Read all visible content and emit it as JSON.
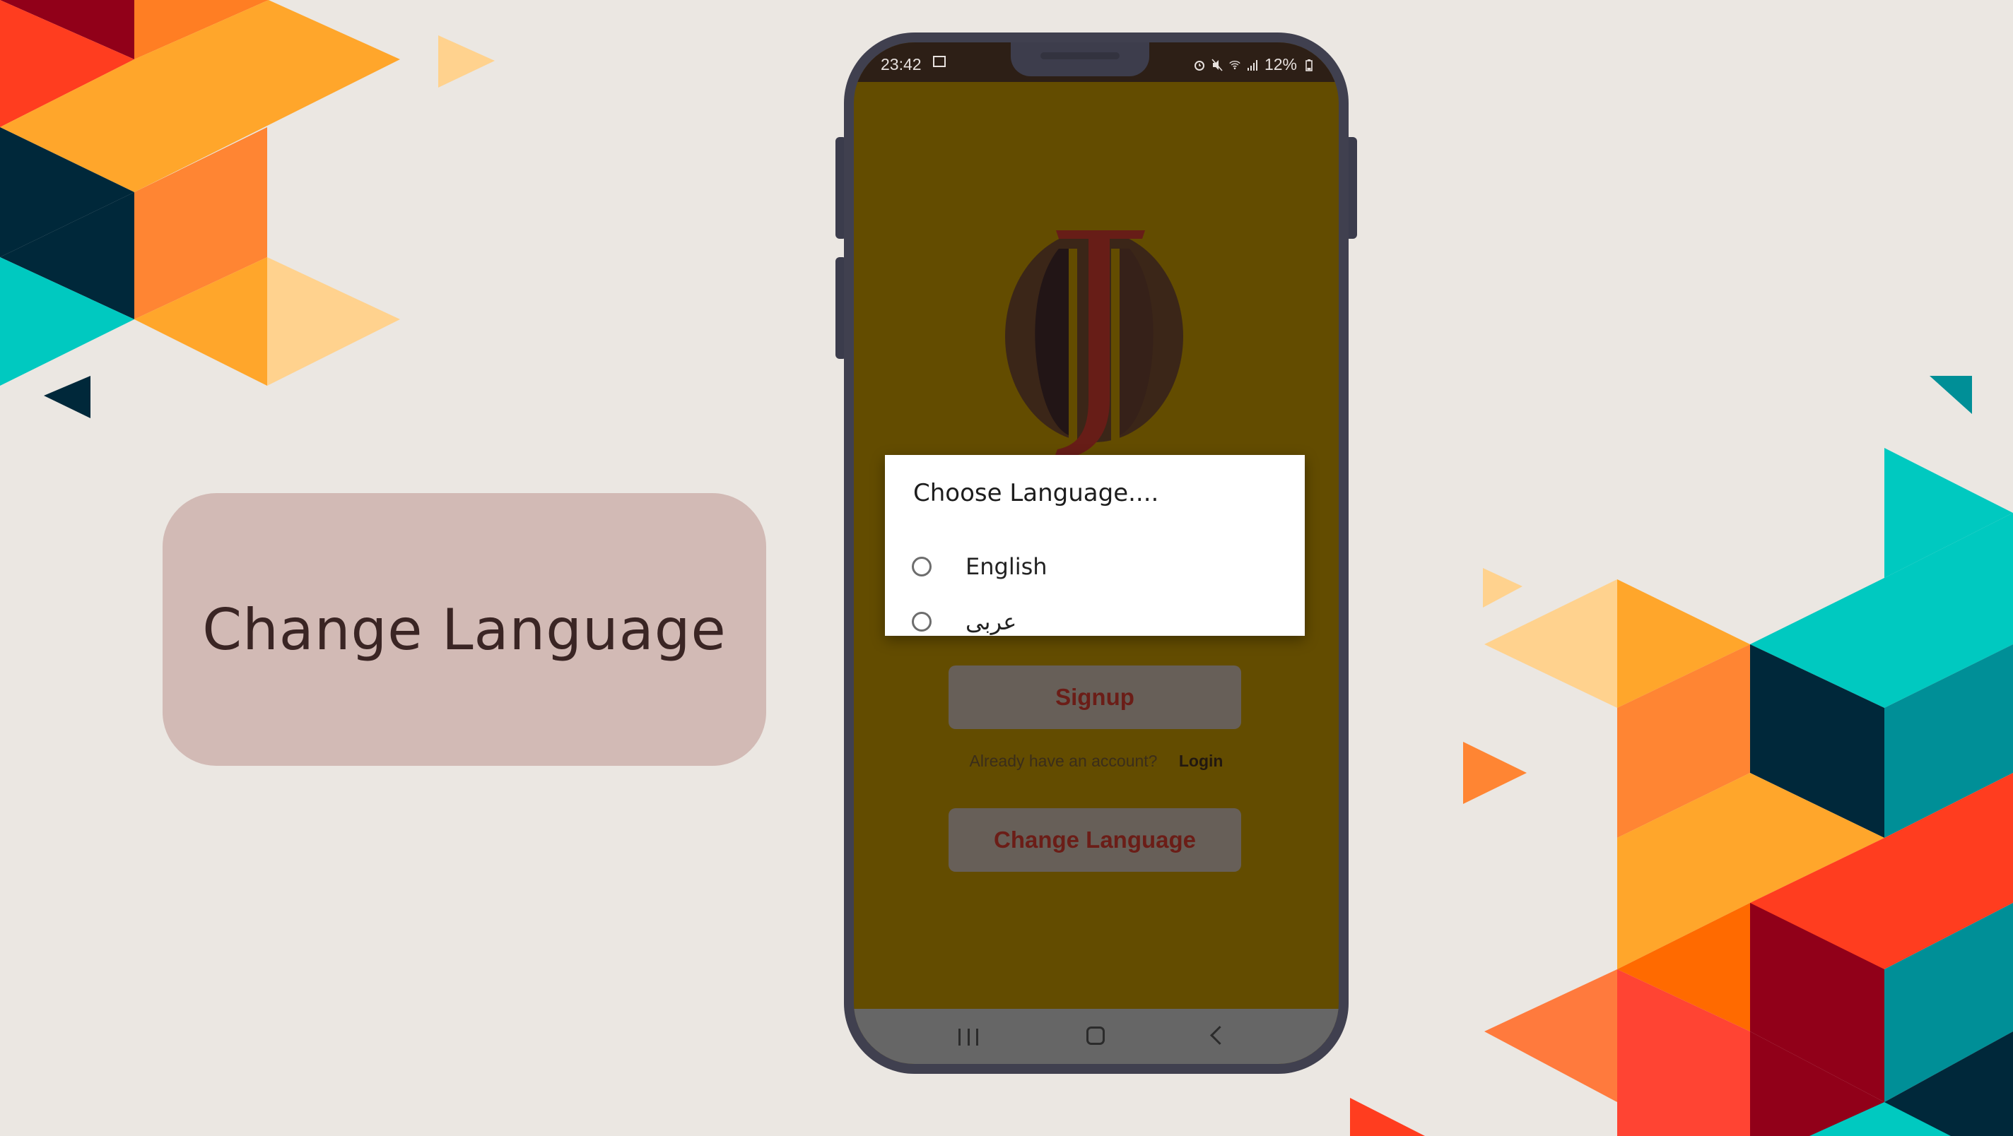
{
  "feature_title": "Change Language",
  "status_bar": {
    "time": "23:42",
    "battery": "12%",
    "icons": [
      "image-icon",
      "alarm-icon",
      "mute-icon",
      "wifi-icon",
      "signal-icon",
      "battery-icon"
    ]
  },
  "app": {
    "logo": "J-logo",
    "signup_label": "Signup",
    "account_prompt": "Already have an account?",
    "login_label": "Login",
    "change_language_label": "Change Language"
  },
  "dialog": {
    "title": "Choose Language....",
    "options": [
      {
        "label": "English",
        "selected": false
      },
      {
        "label": "عربى",
        "selected": false
      }
    ]
  },
  "nav_bar": {
    "icons": [
      "recents-icon",
      "home-icon",
      "back-icon"
    ]
  },
  "colors": {
    "background": "#ebe7e2",
    "app_background_dimmed": "#634c00",
    "button_text": "#6b1d17",
    "pill": "#d2bab5",
    "accent_orange": "#ffa62b",
    "accent_teal": "#00c9c0",
    "accent_red": "#ff3d1f"
  }
}
